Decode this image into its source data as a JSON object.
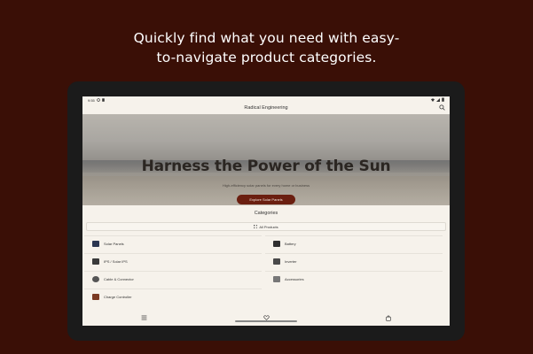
{
  "headline": {
    "line1": "Quickly find what you need with easy-",
    "line2": "to-navigate product categories."
  },
  "statusbar": {
    "time": "9:55",
    "icons": [
      "settings-icon",
      "card-icon",
      "wifi-icon",
      "signal-icon",
      "battery-icon"
    ]
  },
  "appbar": {
    "title": "Radical Engineering",
    "search_icon": "search-icon"
  },
  "hero": {
    "title": "Harness the Power of the Sun",
    "subtitle": "High-efficiency solar panels for every home or business",
    "cta": "Explore Solar Panels"
  },
  "categories": {
    "title": "Categories",
    "all_products": "All Products",
    "items": [
      {
        "label": "Solar Panels",
        "thumb_color": "#2a3550"
      },
      {
        "label": "Battery",
        "thumb_color": "#2f2f2f"
      },
      {
        "label": "IPS / Solar IPS",
        "thumb_color": "#3a3a3a"
      },
      {
        "label": "Inverter",
        "thumb_color": "#4a4a4a"
      },
      {
        "label": "Cable & Connector",
        "thumb_color": "#555555"
      },
      {
        "label": "Accessories",
        "thumb_color": "#777777"
      },
      {
        "label": "Charge Controller",
        "thumb_color": "#7a3a22"
      }
    ]
  },
  "bottom_nav": {
    "items": [
      "menu-icon",
      "favorites-icon",
      "cart-icon"
    ]
  }
}
